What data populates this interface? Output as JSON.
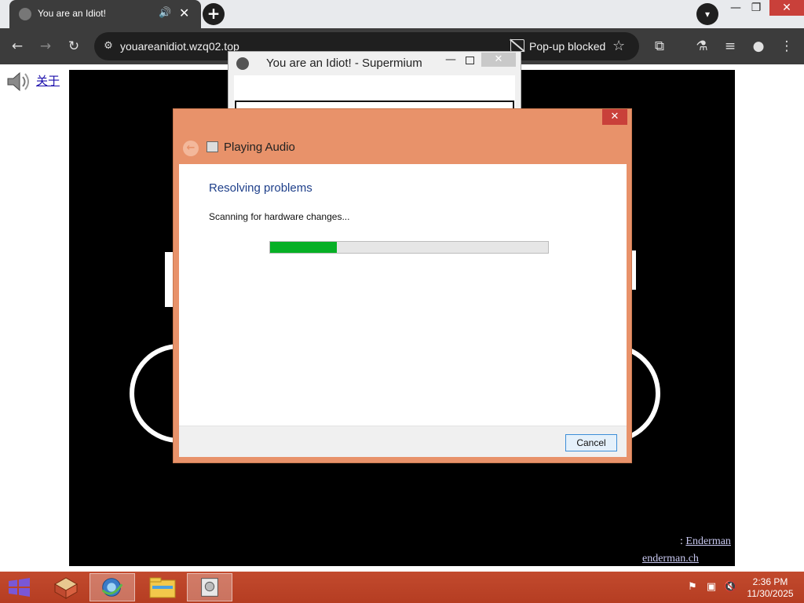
{
  "browser": {
    "tab": {
      "title": "You are an Idiot!",
      "audio_icon": "speaker-icon",
      "close_glyph": "✕"
    },
    "new_tab_glyph": "+",
    "window_controls": {
      "minimize": "—",
      "restore": "❐",
      "close": "✕"
    },
    "toolbar": {
      "back": "←",
      "forward": "→",
      "reload": "↻",
      "url": "youareanidiot.wzq02.top",
      "popup_blocked": "Pop-up blocked",
      "star": "☆",
      "extensions": "⧉",
      "labs": "⚗",
      "media": "≡",
      "profile": "●",
      "menu": "⋮"
    }
  },
  "page": {
    "about_link": "关于",
    "footer": {
      "credit_prefix": ":",
      "credit_name": "Enderman",
      "site": "enderman.ch"
    }
  },
  "popup_window": {
    "title": "You are an Idiot! - Supermium",
    "min": "—",
    "close": "✕"
  },
  "dialog": {
    "title": "Playing Audio",
    "heading": "Resolving problems",
    "status": "Scanning for hardware changes...",
    "progress_fraction": 0.24,
    "cancel_label": "Cancel",
    "close_glyph": "✕",
    "back_glyph": "←"
  },
  "taskbar": {
    "time": "2:36 PM",
    "date": "11/30/2025",
    "tray": {
      "flag": "⚑",
      "network": "▣",
      "volume": "🔇"
    }
  },
  "colors": {
    "dialog_frame": "#e8926a",
    "taskbar": "#c24a2e",
    "progress": "#06b025",
    "heading": "#1e3f8a"
  }
}
